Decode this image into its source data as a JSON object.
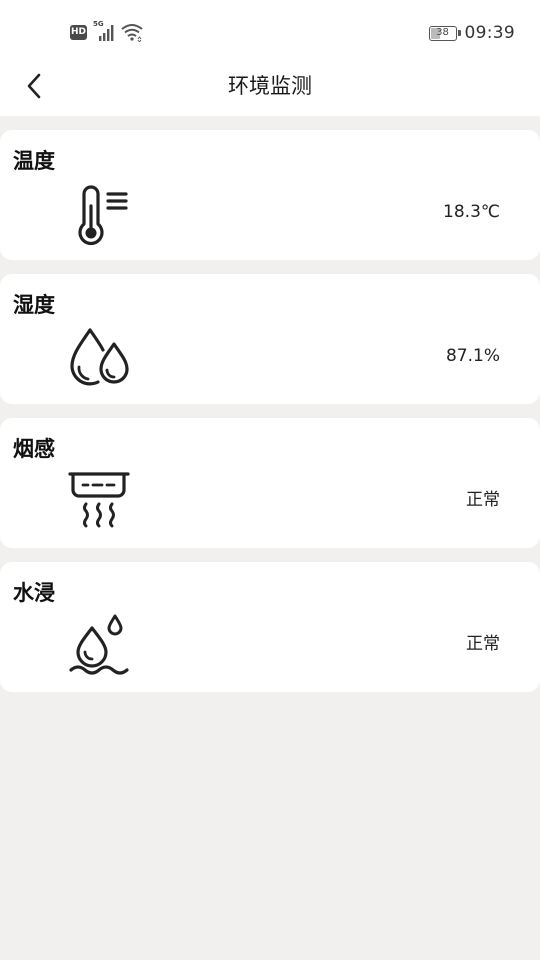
{
  "status_bar": {
    "hd": "HD",
    "network": "5G",
    "battery": "38",
    "time": "09:39"
  },
  "header": {
    "title": "环境监测",
    "back_icon": "chevron-left-icon"
  },
  "cards": [
    {
      "title": "温度",
      "icon": "thermometer-icon",
      "value": "18.3℃"
    },
    {
      "title": "湿度",
      "icon": "water-drops-icon",
      "value": "87.1%"
    },
    {
      "title": "烟感",
      "icon": "smoke-detector-icon",
      "value": "正常"
    },
    {
      "title": "水浸",
      "icon": "water-leak-icon",
      "value": "正常"
    }
  ]
}
